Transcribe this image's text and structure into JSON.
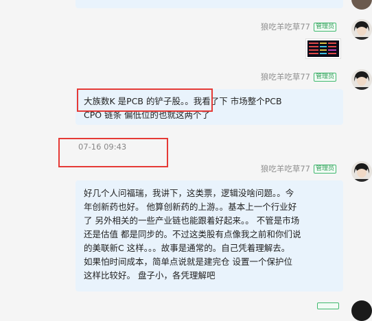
{
  "messages": [
    {
      "sender": "狼吃羊吃草77",
      "badge": "管理员",
      "type": "image"
    },
    {
      "sender": "狼吃羊吃草77",
      "badge": "管理员",
      "lines": [
        "大族数K 是PCB 的铲子股。。我看了下 市场整个PCB",
        "CPO 链条 偏低位的也就这两个了"
      ]
    },
    {
      "sender": "狼吃羊吃草77",
      "badge": "管理员",
      "lines": [
        "好几个人问福瑞，我讲下，这类票，逻辑没啥问题。。今",
        "年创新药也好。  他算创新药的上游。。基本上一个行业好",
        "了 另外相关的一些产业链也能跟着好起来。。 不管是市场",
        "还是估值  都是同步的。不过这类股有点像我之前和你们说",
        "的美联新C 这样。。。故事是通常的。自己凭着理解去。",
        "如果怕时间成本，简单点说就是建完仓  设置一个保护位",
        " 这样比较好。  盘子小，各凭理解吧"
      ]
    }
  ],
  "timestamp": "07-16 09:43",
  "colors": {
    "bubble": "#e9f3fc",
    "badge_green": "#3fb86e",
    "highlight_red": "#e53935",
    "background": "#f5f5f5"
  }
}
